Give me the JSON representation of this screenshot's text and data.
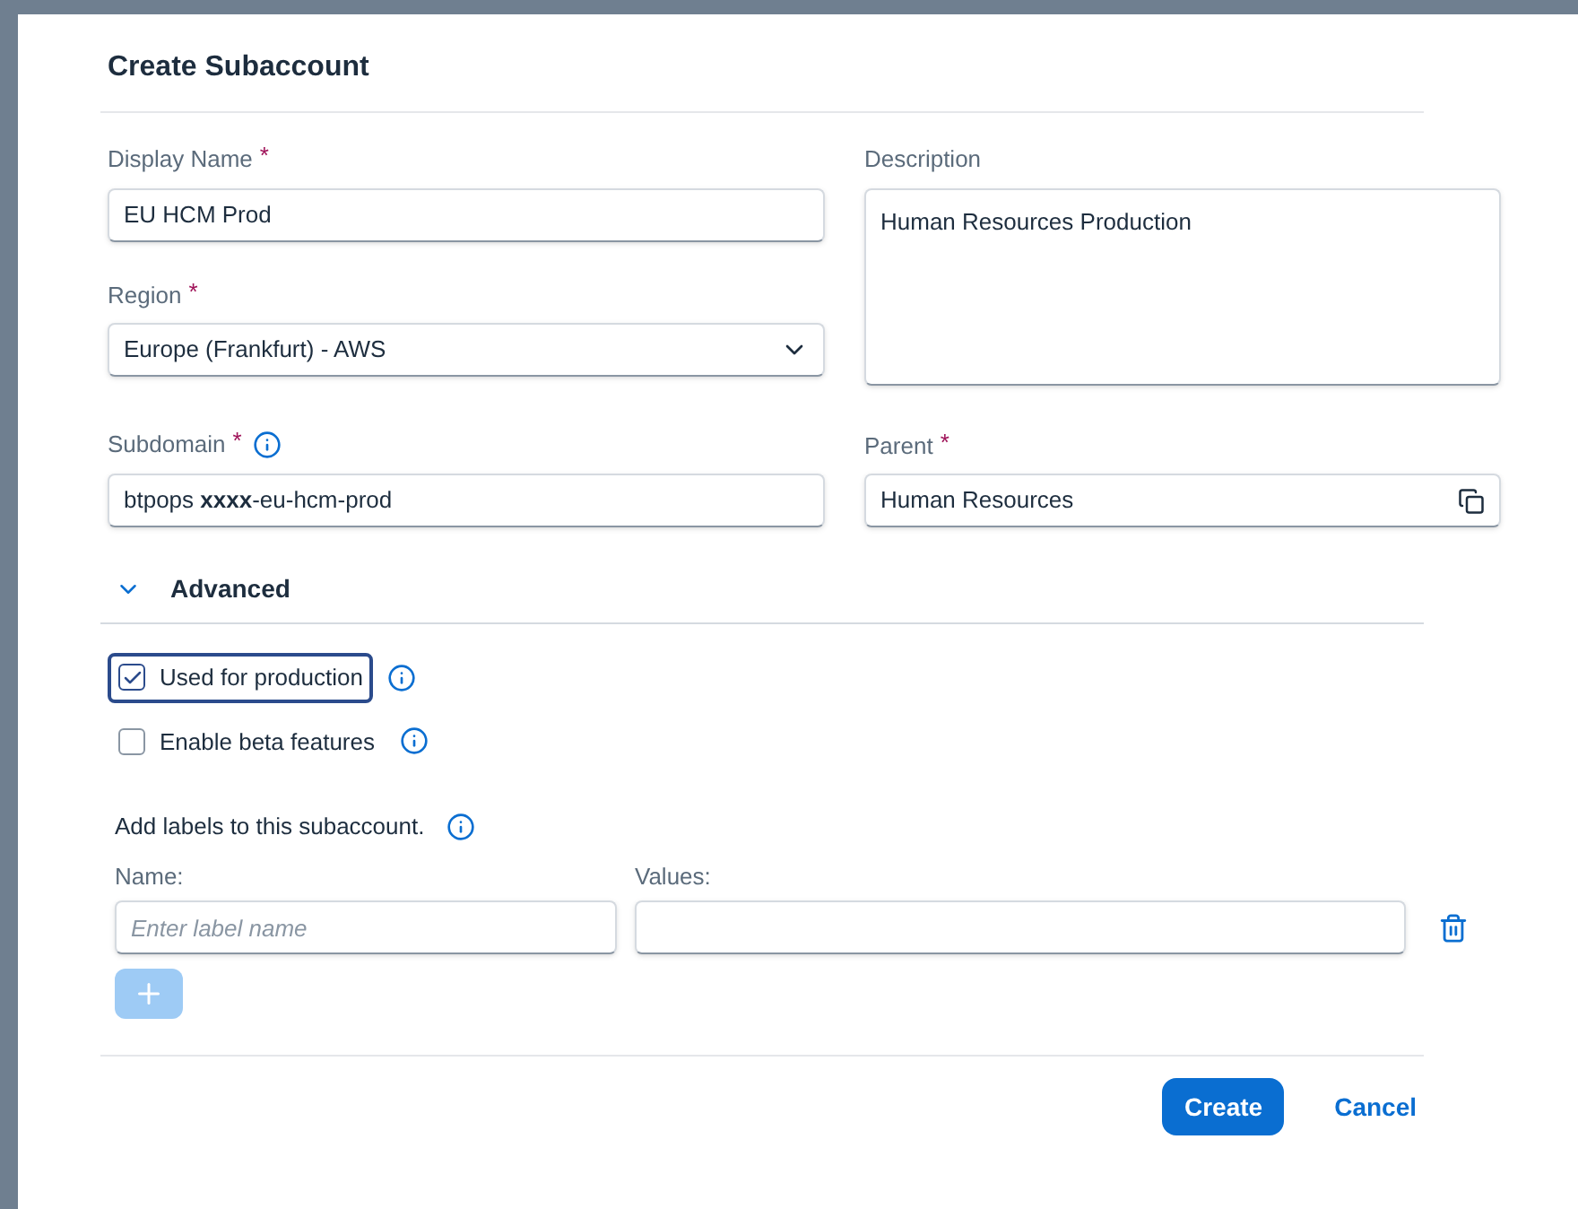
{
  "dialog": {
    "title": "Create Subaccount"
  },
  "display_name": {
    "label": "Display Name",
    "marker": "*",
    "value": "EU HCM Prod"
  },
  "description": {
    "label": "Description",
    "value": "Human Resources Production"
  },
  "region": {
    "label": "Region",
    "marker": "*",
    "value": "Europe (Frankfurt) - AWS"
  },
  "subdomain": {
    "label": "Subdomain",
    "marker": "*",
    "value": "btpops **xxxx**-eu-hcm-prod"
  },
  "parent": {
    "label": "Parent",
    "marker": "*",
    "value": "Human Resources"
  },
  "advanced": {
    "label": "Advanced",
    "expanded": true
  },
  "options": [
    {
      "label": "Used for production",
      "checked": true,
      "focused": true
    },
    {
      "label": "Enable beta features",
      "checked": false,
      "focused": false
    }
  ],
  "labels": {
    "hint": "Add labels to this subaccount.",
    "name_label": "Name:",
    "values_label": "Values:",
    "name_placeholder": "Enter label name"
  },
  "buttons": [
    {
      "label": "Create",
      "kind": "primary"
    },
    {
      "label": "Cancel",
      "kind": "link"
    }
  ]
}
